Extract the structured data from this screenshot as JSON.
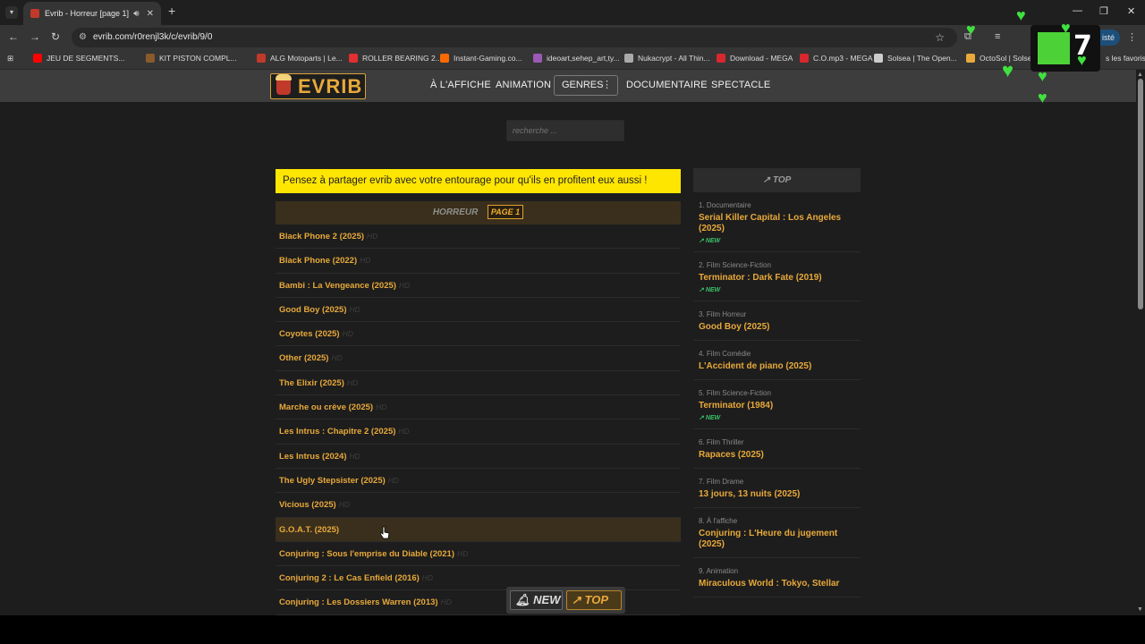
{
  "browser": {
    "tab_title": "Evrib - Horreur [page 1]",
    "url": "evrib.com/r0renjl3k/c/evrib/9/0",
    "profile_label": "isté",
    "bookmarks": [
      {
        "label": "JEU DE SEGMENTS...",
        "color": "#ff0000"
      },
      {
        "label": "KIT PISTON COMPL...",
        "color": "#8a5a2b"
      },
      {
        "label": "ALG Motoparts | Le...",
        "color": "#c0392b"
      },
      {
        "label": "ROLLER BEARING 2...",
        "color": "#e03030"
      },
      {
        "label": "Instant-Gaming.co...",
        "color": "#ff6a00"
      },
      {
        "label": "ideoart,sehep_art,ty...",
        "color": "#9b59b6"
      },
      {
        "label": "Nukacrypt - All Thin...",
        "color": "#aaaaaa"
      },
      {
        "label": "Download - MEGA",
        "color": "#d9272e"
      },
      {
        "label": "C.O.mp3 - MEGA",
        "color": "#d9272e"
      },
      {
        "label": "Solsea | The Open...",
        "color": "#cccccc"
      },
      {
        "label": "OctoSol | Solsea",
        "color": "#e8a93a"
      }
    ],
    "all_bookmarks": "s les favoris"
  },
  "site": {
    "logo": "EVRIB",
    "nav": [
      "À L'AFFICHE",
      "ANIMATION",
      "GENRES",
      "DOCUMENTAIRE",
      "SPECTACLE"
    ],
    "search_placeholder": "recherche ...",
    "banner": "Pensez à partager evrib avec votre entourage pour qu'ils en profitent eux aussi !",
    "list_heading": "HORREUR",
    "page_label": "PAGE 1",
    "quality": "HD",
    "movies": [
      "Black Phone 2 (2025)",
      "Black Phone (2022)",
      "Bambi : La Vengeance (2025)",
      "Good Boy (2025)",
      "Coyotes (2025)",
      "Other (2025)",
      "The Elixir (2025)",
      "Marche ou crève (2025)",
      "Les Intrus : Chapitre 2 (2025)",
      "Les Intrus (2024)",
      "The Ugly Stepsister (2025)",
      "Vicious (2025)",
      "G.O.A.T. (2025)",
      "Conjuring : Sous l'emprise du Diable (2021)",
      "Conjuring 2 : Le Cas Enfield (2016)",
      "Conjuring : Les Dossiers Warren (2013)"
    ],
    "highlighted_index": 12,
    "top_heading": "TOP",
    "new_tag": "NEW",
    "top_items": [
      {
        "meta": "1. Documentaire",
        "title": "Serial Killer Capital : Los Angeles (2025)",
        "is_new": true
      },
      {
        "meta": "2. Film   Science-Fiction",
        "title": "Terminator : Dark Fate (2019)",
        "is_new": true
      },
      {
        "meta": "3. Film   Horreur",
        "title": "Good Boy (2025)",
        "is_new": false
      },
      {
        "meta": "4. Film   Comédie",
        "title": "L'Accident de piano (2025)",
        "is_new": false
      },
      {
        "meta": "5. Film   Science-Fiction",
        "title": "Terminator (1984)",
        "is_new": true
      },
      {
        "meta": "6. Film   Thriller",
        "title": "Rapaces (2025)",
        "is_new": false
      },
      {
        "meta": "7. Film   Drame",
        "title": "13 jours, 13 nuits (2025)",
        "is_new": false
      },
      {
        "meta": "8. À l'affiche",
        "title": "Conjuring : L'Heure du jugement (2025)",
        "is_new": false
      },
      {
        "meta": "9. Animation",
        "title": "Miraculous World : Tokyo, Stellar",
        "is_new": false
      }
    ],
    "float_new": "NEW",
    "float_top": "TOP"
  },
  "overlay": {
    "number": "7"
  }
}
